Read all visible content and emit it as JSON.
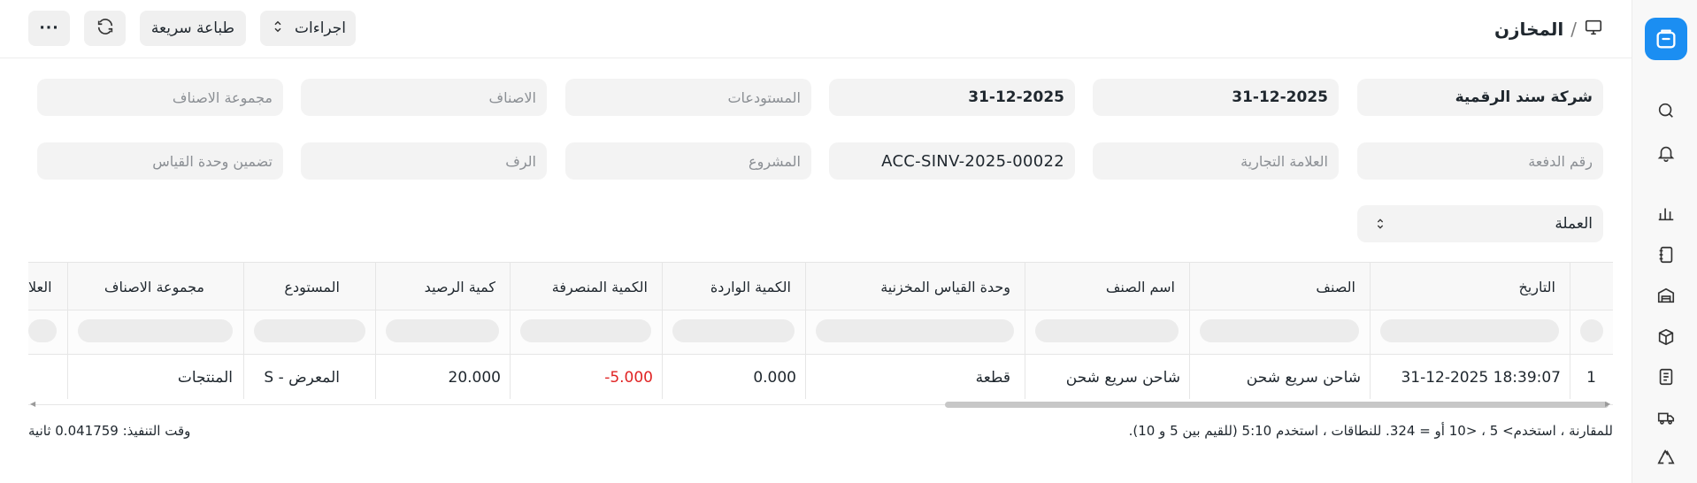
{
  "header": {
    "breadcrumb": "المخازن",
    "separator": "/",
    "actions_label": "اجراءات",
    "quick_print_label": "طباعة سريعة",
    "more_label": "···"
  },
  "filters": {
    "company": "شركة سند الرقمية",
    "from_date": "31-12-2025",
    "to_date": "31-12-2025",
    "warehouses_placeholder": "المستودعات",
    "items_placeholder": "الاصناف",
    "item_groups_placeholder": "مجموعة الاصناف",
    "batch_placeholder": "رقم الدفعة",
    "brand_placeholder": "العلامة التجارية",
    "voucher_no": "ACC-SINV-2025-00022",
    "project_placeholder": "المشروع",
    "shelf_placeholder": "الرف",
    "include_uom_placeholder": "تضمين وحدة القياس",
    "currency_label": "العملة"
  },
  "table": {
    "columns": [
      "التاريخ",
      "الصنف",
      "اسم الصنف",
      "وحدة القياس المخزنية",
      "الكمية الواردة",
      "الكمية المنصرفة",
      "كمية الرصيد",
      "المستودع",
      "مجموعة الاصناف",
      "العلا"
    ],
    "rows": [
      {
        "index": "1",
        "date": "31-12-2025 18:39:07",
        "item": "شاحن سريع شحن",
        "item_name": "شاحن سريع شحن",
        "uom": "قطعة",
        "in_qty": "0.000",
        "out_qty": "-5.000",
        "balance_qty": "20.000",
        "warehouse": "المعرض - S",
        "item_group": "المنتجات"
      }
    ]
  },
  "footer": {
    "comparison_note": "للمقارنة ، استخدم> 5 ، <10 أو = 324. للنطاقات ، استخدم 5:10 (للقيم بين 5 و 10).",
    "execution_time": "وقت التنفيذ: 0.041759 ثانية"
  },
  "colors": {
    "accent": "#1b8ef2",
    "negative": "#e02424"
  },
  "sidebar_icons": [
    "app-logo-icon",
    "search-icon",
    "bell-icon",
    "chart-icon",
    "ledger-icon",
    "warehouse-icon",
    "box-icon",
    "document-icon",
    "truck-icon",
    "recycle-icon"
  ]
}
